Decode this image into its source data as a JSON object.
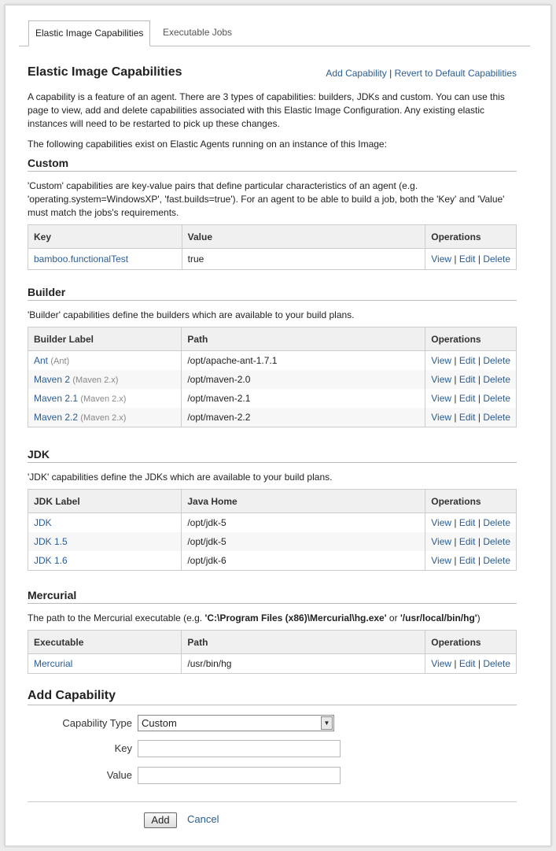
{
  "tabs": [
    {
      "label": "Elastic Image Capabilities"
    },
    {
      "label": "Executable Jobs"
    }
  ],
  "page": {
    "title": "Elastic Image Capabilities",
    "add_capability_link": "Add Capability",
    "link_sep": " | ",
    "revert_link": "Revert to Default Capabilities",
    "intro": "A capability is a feature of an agent. There are 3 types of capabilities: builders, JDKs and custom. You can use this page to view, add and delete capabilities associated with this Elastic Image Configuration. Any existing elastic instances will need to be restarted to pick up these changes.",
    "intro2": "The following capabilities exist on Elastic Agents running on an instance of this Image:"
  },
  "ops": {
    "view": "View",
    "edit": "Edit",
    "delete": "Delete",
    "sep": " | "
  },
  "custom": {
    "title": "Custom",
    "desc": "'Custom' capabilities are key-value pairs that define particular characteristics of an agent (e.g. 'operating.system=WindowsXP', 'fast.builds=true'). For an agent to be able to build a job, both the 'Key' and 'Value' must match the jobs's requirements.",
    "headers": [
      "Key",
      "Value",
      "Operations"
    ],
    "rows": [
      {
        "key": "bamboo.functionalTest",
        "value": "true"
      }
    ]
  },
  "builder": {
    "title": "Builder",
    "desc": "'Builder' capabilities define the builders which are available to your build plans.",
    "headers": [
      "Builder Label",
      "Path",
      "Operations"
    ],
    "rows": [
      {
        "label": "Ant",
        "type": "(Ant)",
        "path": "/opt/apache-ant-1.7.1"
      },
      {
        "label": "Maven 2",
        "type": "(Maven 2.x)",
        "path": "/opt/maven-2.0"
      },
      {
        "label": "Maven 2.1",
        "type": "(Maven 2.x)",
        "path": "/opt/maven-2.1"
      },
      {
        "label": "Maven 2.2",
        "type": "(Maven 2.x)",
        "path": "/opt/maven-2.2"
      }
    ]
  },
  "jdk": {
    "title": "JDK",
    "desc": "'JDK' capabilities define the JDKs which are available to your build plans.",
    "headers": [
      "JDK Label",
      "Java Home",
      "Operations"
    ],
    "rows": [
      {
        "label": "JDK",
        "path": "/opt/jdk-5"
      },
      {
        "label": "JDK 1.5",
        "path": "/opt/jdk-5"
      },
      {
        "label": "JDK 1.6",
        "path": "/opt/jdk-6"
      }
    ]
  },
  "mercurial": {
    "title": "Mercurial",
    "desc_pre": "The path to the Mercurial executable (e.g. ",
    "desc_ex1": "'C:\\Program Files (x86)\\Mercurial\\hg.exe'",
    "desc_mid": " or ",
    "desc_ex2": "'/usr/local/bin/hg'",
    "desc_post": ")",
    "headers": [
      "Executable",
      "Path",
      "Operations"
    ],
    "rows": [
      {
        "label": "Mercurial",
        "path": "/usr/bin/hg"
      }
    ]
  },
  "form": {
    "title": "Add Capability",
    "type_label": "Capability Type",
    "type_value": "Custom",
    "key_label": "Key",
    "value_label": "Value",
    "add_button": "Add",
    "cancel_link": "Cancel"
  },
  "colors": {
    "link": "#2a5d94",
    "header_bg": "#f0f0f0"
  }
}
